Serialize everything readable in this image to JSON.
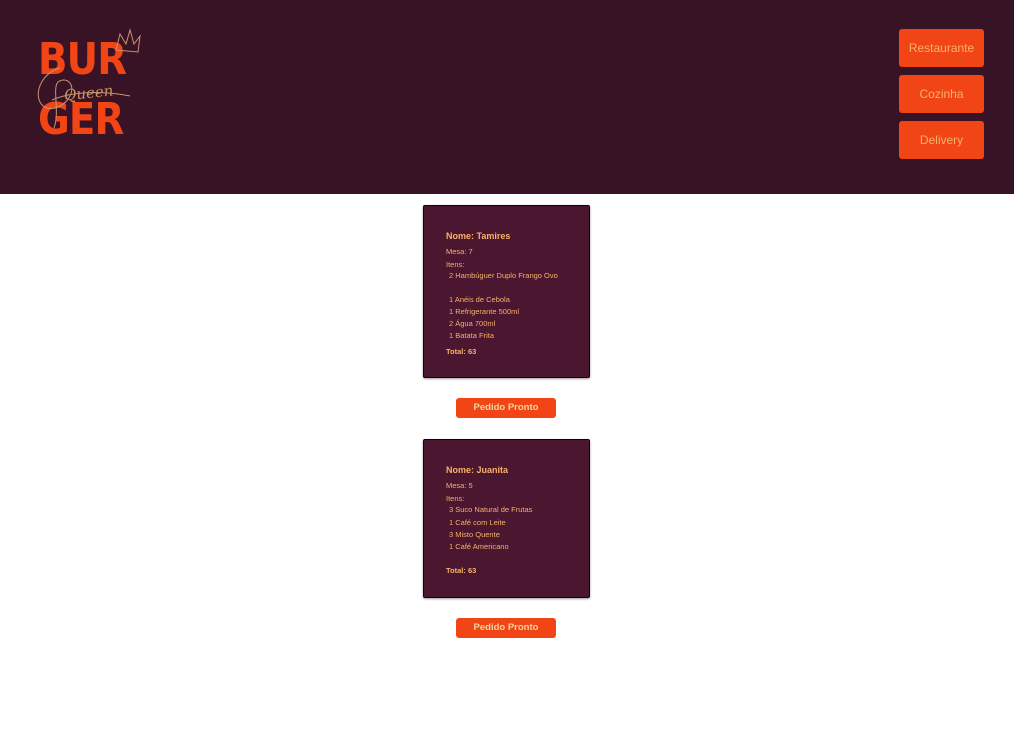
{
  "brand": {
    "logo_top": "BUR",
    "logo_bottom": "GER",
    "logo_script": "Queen",
    "colors": {
      "header_bg": "#381225",
      "accent": "#f24516",
      "card_bg": "#4a1630",
      "card_text": "#f6b26b"
    }
  },
  "nav": {
    "items": [
      {
        "label": "Restaurante"
      },
      {
        "label": "Cozinha"
      },
      {
        "label": "Delivery"
      }
    ]
  },
  "orders": [
    {
      "name": "Nome: Tamires",
      "table": "Mesa: 7",
      "items_label": "Itens:",
      "items": [
        "2 Hambúguer Duplo Frango Ovo",
        "1 Anéis de Cebola",
        "1 Refrigerante 500ml",
        "2 Água 700ml",
        "1 Batata Frita"
      ],
      "total": "Total: 63",
      "button_label": "Pedido Pronto"
    },
    {
      "name": "Nome: Juanita",
      "table": "Mesa: 5",
      "items_label": "Itens:",
      "items": [
        "3 Suco Natural de Frutas",
        "1 Café com Leite",
        "3 Misto Quente",
        "1 Café Americano"
      ],
      "total": "Total: 63",
      "button_label": "Pedido Pronto"
    }
  ]
}
